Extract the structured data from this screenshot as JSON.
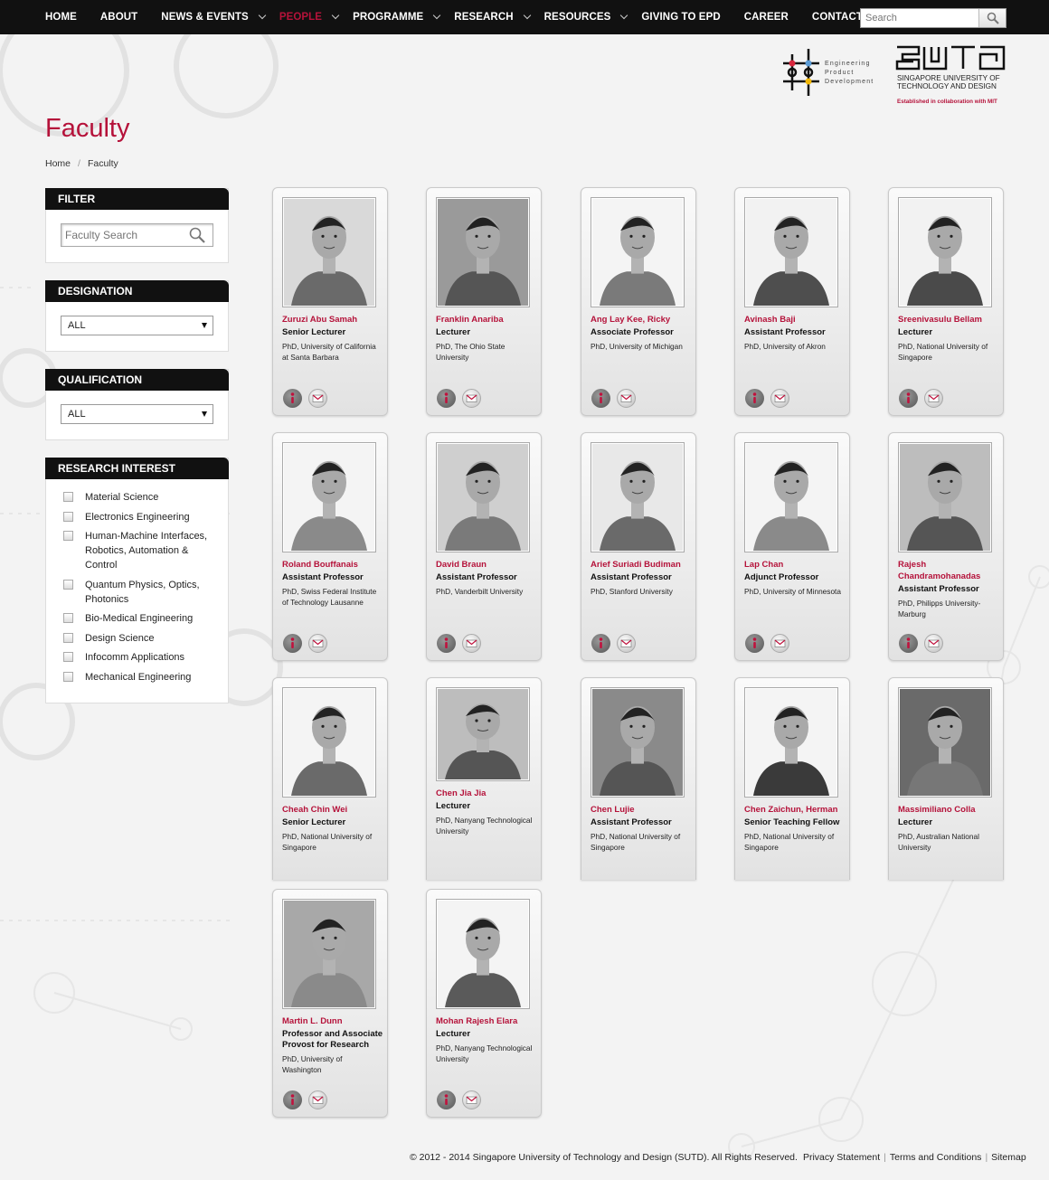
{
  "nav": {
    "items": [
      {
        "label": "HOME",
        "dropdown": false,
        "active": false
      },
      {
        "label": "ABOUT",
        "dropdown": false,
        "active": false
      },
      {
        "label": "NEWS & EVENTS",
        "dropdown": true,
        "active": false
      },
      {
        "label": "PEOPLE",
        "dropdown": true,
        "active": true
      },
      {
        "label": "PROGRAMME",
        "dropdown": true,
        "active": false
      },
      {
        "label": "RESEARCH",
        "dropdown": true,
        "active": false
      },
      {
        "label": "RESOURCES",
        "dropdown": true,
        "active": false
      },
      {
        "label": "GIVING TO EPD",
        "dropdown": false,
        "active": false
      },
      {
        "label": "CAREER",
        "dropdown": false,
        "active": false
      },
      {
        "label": "CONTACT US",
        "dropdown": false,
        "active": false
      }
    ],
    "search_placeholder": "Search"
  },
  "logos": {
    "epd": {
      "line1": "Engineering",
      "line2": "Product",
      "line3": "Development"
    },
    "sutd": {
      "line1": "SINGAPORE UNIVERSITY OF",
      "line2": "TECHNOLOGY AND DESIGN",
      "tagline": "Established in collaboration with MIT"
    }
  },
  "page": {
    "title": "Faculty",
    "breadcrumb": {
      "home": "Home",
      "current": "Faculty"
    }
  },
  "sidebar": {
    "filter": {
      "title": "FILTER",
      "search_placeholder": "Faculty Search"
    },
    "designation": {
      "title": "DESIGNATION",
      "selected": "ALL"
    },
    "qualification": {
      "title": "QUALIFICATION",
      "selected": "ALL"
    },
    "research": {
      "title": "RESEARCH INTEREST",
      "items": [
        "Material Science",
        "Electronics Engineering",
        "Human-Machine Interfaces, Robotics, Automation & Control",
        "Quantum Physics, Optics, Photonics",
        "Bio-Medical Engineering",
        "Design Science",
        "Infocomm Applications",
        "Mechanical Engineering"
      ]
    }
  },
  "faculty": [
    {
      "name": "Zuruzi Abu Samah",
      "designation": "Senior Lecturer",
      "qualification": "PhD, University of California at Santa Barbara",
      "shade": "#6a6a6a",
      "bg": "#d9d9d9"
    },
    {
      "name": "Franklin Anariba",
      "designation": "Lecturer",
      "qualification": "PhD, The Ohio State University",
      "shade": "#555",
      "bg": "#9a9a9a"
    },
    {
      "name": "Ang Lay Kee, Ricky",
      "designation": "Associate Professor",
      "qualification": "PhD, University of Michigan",
      "shade": "#7a7a7a",
      "bg": "#f4f4f4"
    },
    {
      "name": "Avinash Baji",
      "designation": "Assistant Professor",
      "qualification": "PhD, University of Akron",
      "shade": "#4e4e4e",
      "bg": "#f2f2f2"
    },
    {
      "name": "Sreenivasulu Bellam",
      "designation": "Lecturer",
      "qualification": "PhD, National University of Singapore",
      "shade": "#4a4a4a",
      "bg": "#f2f2f2"
    },
    {
      "name": "Roland Bouffanais",
      "designation": "Assistant Professor",
      "qualification": "PhD, Swiss Federal Institute of Technology Lausanne",
      "shade": "#8a8a8a",
      "bg": "#f4f4f4"
    },
    {
      "name": "David Braun",
      "designation": "Assistant Professor",
      "qualification": "PhD, Vanderbilt University",
      "shade": "#7a7a7a",
      "bg": "#cfcfcf"
    },
    {
      "name": "Arief Suriadi Budiman",
      "designation": "Assistant Professor",
      "qualification": "PhD, Stanford University",
      "shade": "#6a6a6a",
      "bg": "#e8e8e8"
    },
    {
      "name": "Lap Chan",
      "designation": "Adjunct Professor",
      "qualification": "PhD, University of Minnesota",
      "shade": "#8a8a8a",
      "bg": "#f4f4f4"
    },
    {
      "name": "Rajesh Chandramohanadas",
      "designation": "Assistant Professor",
      "qualification": "PhD, Philipps University- Marburg",
      "shade": "#555",
      "bg": "#bdbdbd"
    },
    {
      "name": "Cheah Chin Wei",
      "designation": "Senior Lecturer",
      "qualification": "PhD, National University of Singapore",
      "shade": "#6a6a6a",
      "bg": "#f4f4f4"
    },
    {
      "name": "Chen Jia Jia",
      "designation": "Lecturer",
      "qualification": "PhD, Nanyang Technological University",
      "shade": "#555",
      "bg": "#bdbdbd"
    },
    {
      "name": "Chen Lujie",
      "designation": "Assistant Professor",
      "qualification": "PhD, National University of Singapore",
      "shade": "#555",
      "bg": "#8a8a8a"
    },
    {
      "name": "Chen Zaichun, Herman",
      "designation": "Senior Teaching Fellow",
      "qualification": "PhD, National University of Singapore",
      "shade": "#3a3a3a",
      "bg": "#f4f4f4"
    },
    {
      "name": "Massimiliano Colla",
      "designation": "Lecturer",
      "qualification": "PhD, Australian National University",
      "shade": "#777",
      "bg": "#6a6a6a"
    },
    {
      "name": "Martin L. Dunn",
      "designation": "Professor and Associate Provost for Research",
      "qualification": "PhD, University of Washington",
      "shade": "#8a8a8a",
      "bg": "#a8a8a8"
    },
    {
      "name": "Mohan Rajesh Elara",
      "designation": "Lecturer",
      "qualification": "PhD, Nanyang Technological University",
      "shade": "#5a5a5a",
      "bg": "#f4f4f4"
    }
  ],
  "footer": {
    "copyright": "© 2012 - 2014 Singapore University of Technology and Design (SUTD). All Rights Reserved.",
    "privacy": "Privacy Statement",
    "terms": "Terms and Conditions",
    "sitemap": "Sitemap"
  }
}
